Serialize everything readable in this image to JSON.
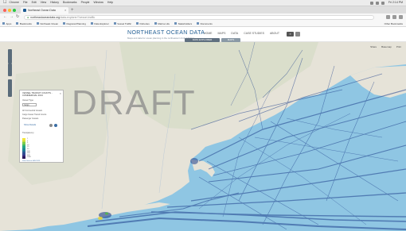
{
  "browser": {
    "menubar": {
      "apple": "",
      "items": [
        "Chrome",
        "File",
        "Edit",
        "View",
        "History",
        "Bookmarks",
        "People",
        "Window",
        "Help"
      ],
      "clock": "Fri 2:14 PM"
    },
    "tab_title": "Northeast Ocean Data",
    "address_main": "northeastoceandata.org",
    "address_rest": "/data-explorer/?vessel-traffic",
    "bookmarks": [
      "Apps",
      "Bookmarks",
      "Northeast Ocean",
      "Regional Planning",
      "Data Explorer",
      "Vessel Traffic",
      "Fisheries",
      "Marine Life",
      "Stakeholders",
      "Documents"
    ],
    "other_bookmarks": "Other Bookmarks"
  },
  "site": {
    "title": "NORTHEAST OCEAN DATA",
    "subtitle": "Maps and data for ocean planning in the northeastern United States",
    "nav": [
      "HOME",
      "MAPS",
      "DATA",
      "CASE STUDIES",
      "ABOUT"
    ],
    "map_tab": "DATA EXPLORER",
    "map_tab2": "MAPS"
  },
  "map": {
    "watermark": "DRAFT",
    "controls": [
      "Share",
      "Basemap",
      "Print"
    ]
  },
  "panel": {
    "title": "VESSEL TRANSIT COUNTS - COMMERCIAL 2013",
    "close": "×",
    "subtitle": "Vessel Type",
    "select_value": "Cargo",
    "rows": [
      "All Commercial Vessels",
      "Cargo Vessel Transit Counts",
      "Passenger Vessels"
    ],
    "button": "Show Details",
    "transparency_label": "Transparency",
    "scale_labels": [
      "1",
      "2",
      "5",
      "10",
      "25",
      "50",
      "100",
      "250",
      "500",
      "1000"
    ],
    "footer": "Data Source: AIS 2013"
  },
  "colors": {
    "accent": "#1d5b92",
    "land": "#e7e4da",
    "water": "#8fc6e3",
    "traffic": "#1e3f8c"
  }
}
